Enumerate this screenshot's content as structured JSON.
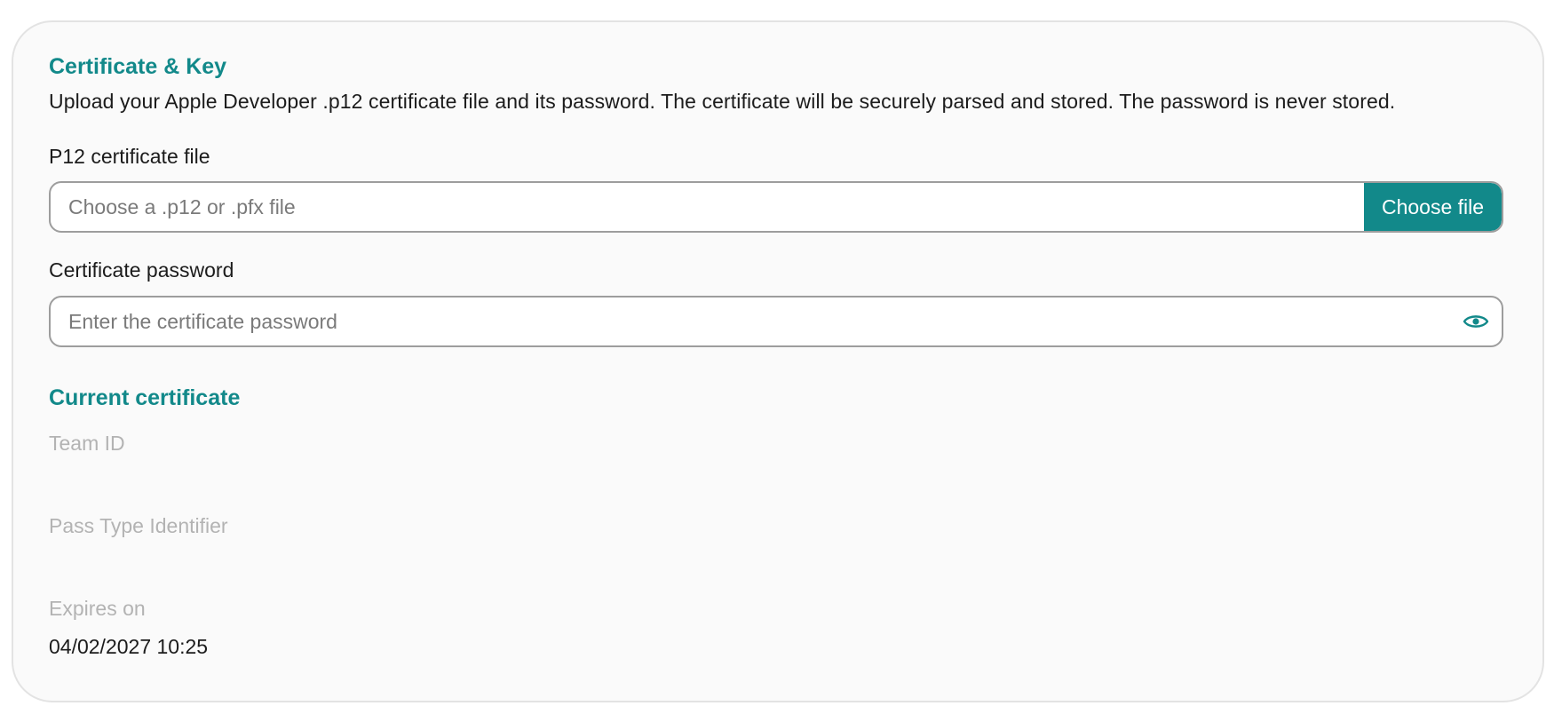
{
  "certificate_section": {
    "title": "Certificate & Key",
    "description": "Upload your Apple Developer .p12 certificate file and its password. The certificate will be securely parsed and stored. The password is never stored."
  },
  "file_field": {
    "label": "P12 certificate file",
    "placeholder": "Choose a .p12 or .pfx file",
    "button_label": "Choose file"
  },
  "password_field": {
    "label": "Certificate password",
    "placeholder": "Enter the certificate password",
    "toggle_icon": "eye-icon"
  },
  "current_certificate": {
    "title": "Current certificate",
    "team_id_label": "Team ID",
    "team_id_value": "",
    "pass_type_label": "Pass Type Identifier",
    "pass_type_value": "",
    "expires_label": "Expires on",
    "expires_value": "04/02/2027 10:25"
  },
  "colors": {
    "accent": "#12898a",
    "muted_label": "#b3b3b3",
    "text": "#1c1c1c",
    "card_background": "#fafafa"
  }
}
